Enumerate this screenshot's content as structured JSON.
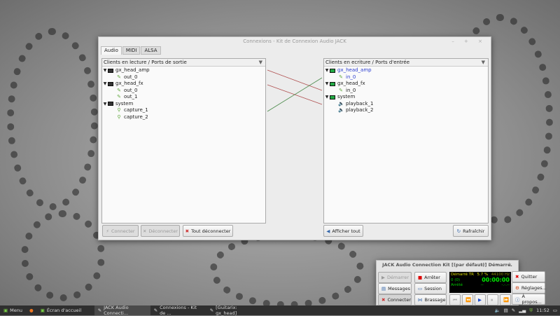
{
  "connections": {
    "title": "Connexions - Kit de Connexion Audio JACK",
    "tabs": [
      "Audio",
      "MIDI",
      "ALSA"
    ],
    "left_header": "Clients en lecture / Ports de sortie",
    "right_header": "Clients en ecriture / Ports d'entrée",
    "left_tree": [
      {
        "client": "gx_head_amp",
        "ports": [
          "out_0"
        ]
      },
      {
        "client": "gx_head_fx",
        "ports": [
          "out_0",
          "out_1"
        ]
      },
      {
        "client": "system",
        "ports": [
          "capture_1",
          "capture_2"
        ]
      }
    ],
    "right_tree": [
      {
        "client": "gx_head_amp",
        "ports": [
          "in_0"
        ]
      },
      {
        "client": "gx_head_fx",
        "ports": [
          "in_0"
        ]
      },
      {
        "client": "system",
        "ports": [
          "playback_1",
          "playback_2"
        ]
      }
    ],
    "buttons": {
      "connect": "Connecter",
      "disconnect": "Déconnecter",
      "disconnect_all": "Tout déconnecter",
      "show_all": "Afficher tout",
      "refresh": "Rafraîchir"
    },
    "colors": {
      "link_red": "#b05050",
      "link_green": "#4a8a4a",
      "highlight": "#2a3cd0"
    }
  },
  "jack": {
    "title": "JACK Audio Connection Kit [(par défaut)] Démarré.",
    "start": "Démarrer",
    "stop": "Arrêter",
    "quit": "Quitter",
    "messages": "Messages",
    "session": "Session",
    "settings": "Réglages...",
    "connect": "Connecter",
    "patchbay": "Brassage",
    "about": "À propos...",
    "display": {
      "status": "Démarré TR",
      "dsp": "5.7 %",
      "rate": "44100 Hz",
      "xruns": "0 (0)",
      "time": "00:00:00",
      "transport": "Arrêté",
      "dash1": "--",
      "dash2": "-.-.--"
    }
  },
  "taskbar": {
    "menu": "Menu",
    "items": [
      "Écran d'accueil",
      "JACK Audio Connecti...",
      "Connexions - Kit de ...",
      "[Guitarix: gx_head]"
    ],
    "clock": "11:52"
  }
}
